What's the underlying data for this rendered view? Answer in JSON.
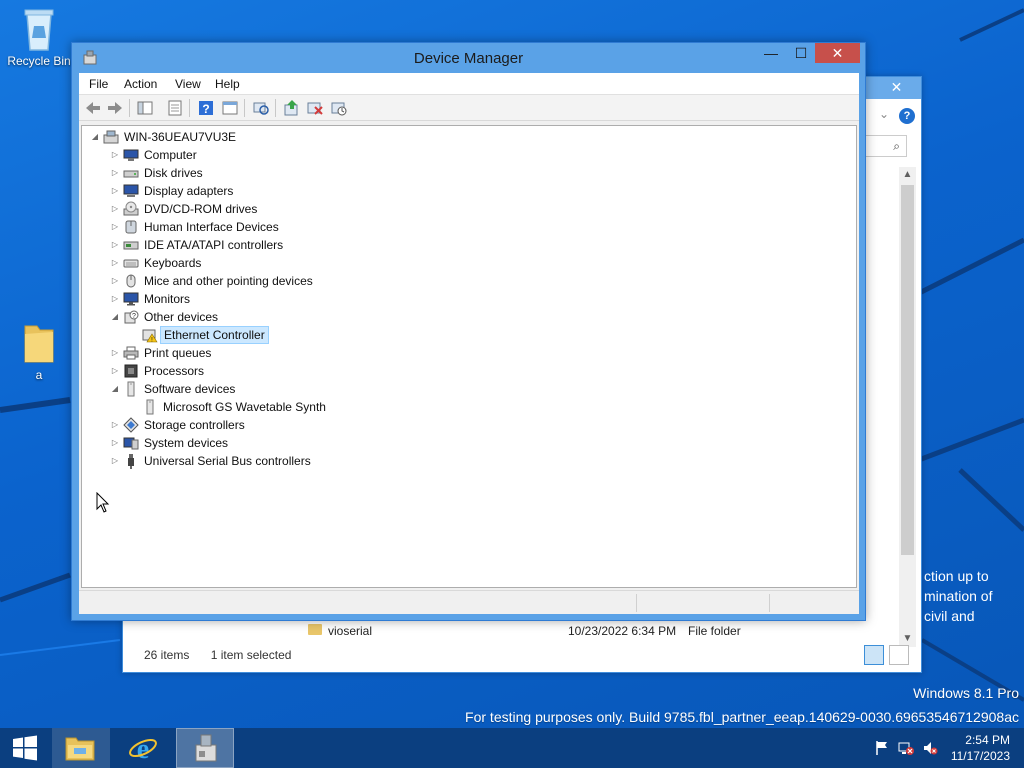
{
  "desktop": {
    "icons": [
      {
        "label": "Recycle Bin"
      },
      {
        "label": "a"
      }
    ],
    "watermark": {
      "edition": "Windows 8.1 Pro",
      "build": "For testing purposes only. Build 9785.fbl_partner_eeap.140629-0030.69653546712908ac"
    },
    "background_text": [
      "ction up to",
      "mination of",
      "civil and"
    ]
  },
  "explorer": {
    "close": "✕",
    "help": "?",
    "search_glyph": "⌕",
    "row": {
      "name": "vioserial",
      "date": "10/23/2022 6:34 PM",
      "type": "File folder"
    },
    "status": {
      "items": "26 items",
      "selected": "1 item selected"
    }
  },
  "device_manager": {
    "title": "Device Manager",
    "controls": {
      "minimize": "—",
      "maximize": "☐",
      "close": "✕"
    },
    "menu": [
      "File",
      "Action",
      "View",
      "Help"
    ],
    "toolbar_icons": [
      "back-arrow-icon",
      "forward-arrow-icon",
      "show-hide-console-tree-icon",
      "properties-icon",
      "help-icon",
      "view-icon",
      "scan-hardware-icon",
      "update-driver-icon",
      "uninstall-icon",
      "disable-icon"
    ],
    "tree": {
      "root": "WIN-36UEAU7VU3E",
      "nodes": [
        {
          "label": "Computer",
          "state": "collapsed",
          "depth": 1
        },
        {
          "label": "Disk drives",
          "state": "collapsed",
          "depth": 1
        },
        {
          "label": "Display adapters",
          "state": "collapsed",
          "depth": 1
        },
        {
          "label": "DVD/CD-ROM drives",
          "state": "collapsed",
          "depth": 1
        },
        {
          "label": "Human Interface Devices",
          "state": "collapsed",
          "depth": 1
        },
        {
          "label": "IDE ATA/ATAPI controllers",
          "state": "collapsed",
          "depth": 1
        },
        {
          "label": "Keyboards",
          "state": "collapsed",
          "depth": 1
        },
        {
          "label": "Mice and other pointing devices",
          "state": "collapsed",
          "depth": 1
        },
        {
          "label": "Monitors",
          "state": "collapsed",
          "depth": 1
        },
        {
          "label": "Other devices",
          "state": "expanded",
          "depth": 1
        },
        {
          "label": "Ethernet Controller",
          "state": "leaf",
          "depth": 2,
          "selected": true,
          "warning": true
        },
        {
          "label": "Print queues",
          "state": "collapsed",
          "depth": 1
        },
        {
          "label": "Processors",
          "state": "collapsed",
          "depth": 1
        },
        {
          "label": "Software devices",
          "state": "expanded",
          "depth": 1
        },
        {
          "label": "Microsoft GS Wavetable Synth",
          "state": "leaf",
          "depth": 2
        },
        {
          "label": "Storage controllers",
          "state": "collapsed",
          "depth": 1
        },
        {
          "label": "System devices",
          "state": "collapsed",
          "depth": 1
        },
        {
          "label": "Universal Serial Bus controllers",
          "state": "collapsed",
          "depth": 1
        }
      ]
    }
  },
  "taskbar": {
    "items": [
      "start",
      "file-explorer",
      "internet-explorer",
      "device-manager"
    ],
    "time": "2:54 PM",
    "date": "11/17/2023"
  },
  "colors": {
    "desktop_blue": "#0b63cd",
    "title_blue": "#5aa2e7",
    "close_red": "#c7504b",
    "selection": "#cce8ff"
  }
}
